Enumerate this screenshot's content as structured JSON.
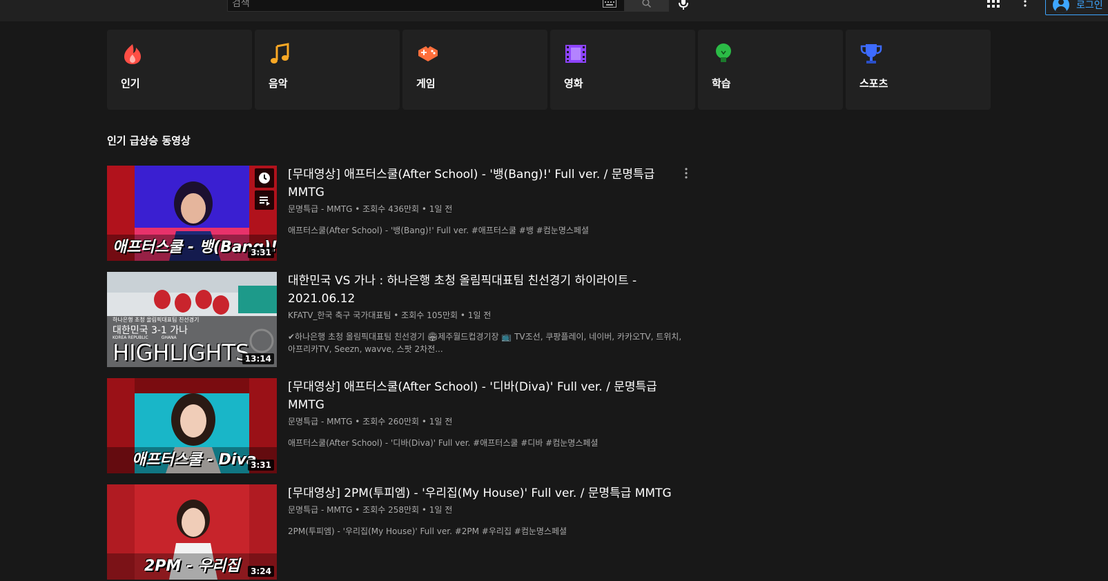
{
  "search": {
    "placeholder": "검색"
  },
  "header": {
    "login_label": "로그인"
  },
  "categories": [
    {
      "label": "인기",
      "icon": "fire-icon",
      "color": "#ff4e45"
    },
    {
      "label": "음악",
      "icon": "music-note-icon",
      "color": "#f9a825"
    },
    {
      "label": "게임",
      "icon": "gamepad-icon",
      "color": "#ff6f3c"
    },
    {
      "label": "영화",
      "icon": "film-icon",
      "color": "#8e44ff"
    },
    {
      "label": "학습",
      "icon": "lightbulb-icon",
      "color": "#2bbb46"
    },
    {
      "label": "스포츠",
      "icon": "trophy-icon",
      "color": "#3d6bff"
    }
  ],
  "section": {
    "title": "인기 급상승 동영상"
  },
  "videos": [
    {
      "title": "[무대영상] 애프터스쿨(After School) - '뱅(Bang)!' Full ver. / 문명특급 MMTG",
      "meta": "문명특급 - MMTG • 조회수 436만회 • 1일 전",
      "desc": "애프터스쿨(After School) - '뱅(Bang)!' Full ver. #애프터스쿨 #뱅 #컴눈명스페셜",
      "duration": "3:31",
      "caption": "애프터스쿨 - 뱅(Bang)!"
    },
    {
      "title": "대한민국 VS 가나 : 하나은행 초청 올림픽대표팀 친선경기 하이라이트 - 2021.06.12",
      "meta": "KFATV_한국 축구 국가대표팀 • 조회수 105만회 • 1일 전",
      "desc": "✔하나은행 초청 올림픽대표팀 친선경기 🏟제주월드컵경기장 📺 TV조선, 쿠팡플레이, 네이버, 카카오TV, 트위치, 아프리카TV, Seezn, wavve, 스팟 2차전...",
      "duration": "13:14",
      "caption": "HIGHLIGHTS",
      "caption_small": "하나은행 초청 올림픽대표팀 친선경기",
      "caption_mid": "대한민국 3-1 가나",
      "caption_teams": "KOREA REPUBLIC          GHANA"
    },
    {
      "title": "[무대영상] 애프터스쿨(After School) - '디바(Diva)' Full ver. / 문명특급 MMTG",
      "meta": "문명특급 - MMTG • 조회수 260만회 • 1일 전",
      "desc": "애프터스쿨(After School) - '디바(Diva)' Full ver. #애프터스쿨 #디바 #컴눈명스페셜",
      "duration": "3:31",
      "caption": "애프터스쿨 - Diva"
    },
    {
      "title": "[무대영상] 2PM(투피엠) - '우리집(My House)' Full ver. / 문명특급 MMTG",
      "meta": "문명특급 - MMTG • 조회수 258만회 • 1일 전",
      "desc": "2PM(투피엠) - '우리집(My House)' Full ver. #2PM #우리집 #컴눈명스페셜",
      "duration": "3:24",
      "caption": "2PM - 우리집"
    }
  ]
}
